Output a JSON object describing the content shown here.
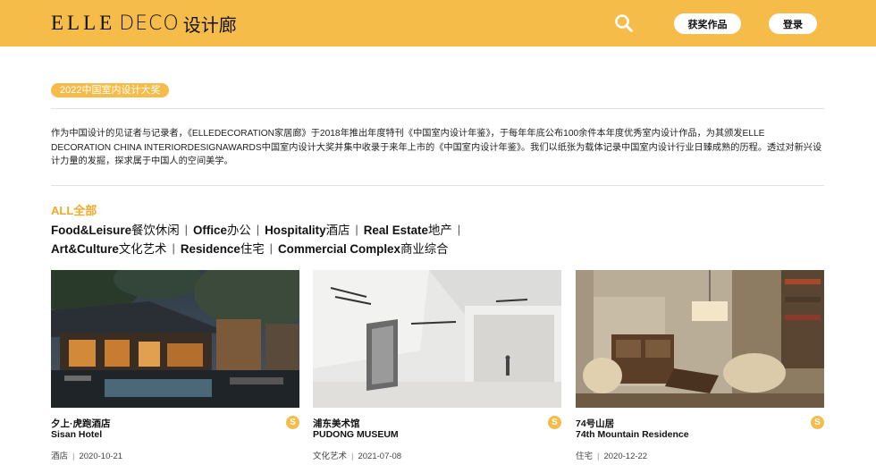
{
  "header": {
    "logo_elle": "ELLE",
    "logo_deco": "DECO",
    "logo_cn": "设计廊",
    "awards_label": "获奖作品",
    "login_label": "登录",
    "bg_color": "#f5bc4a"
  },
  "tag": "2022中国室内设计大奖",
  "description": "作为中国设计的见证者与记录者，《ELLEDECORATION家居廊》于2018年推出年度特刊《中国室内设计年鉴》，于每年年底公布100余件本年度优秀室内设计作品，为其颁发ELLE DECORATION CHINA INTERIORDESIGNAWARDS中国室内设计大奖并集中收录于来年上市的《中国室内设计年鉴》。我们以纸张为载体记录中国室内设计行业日臻成熟的历程。透过对新兴设计力量的发掘，探求属于中国人的空间美学。",
  "categories": {
    "all": "ALL全部",
    "line1": [
      {
        "en": "Food&Leisure",
        "cn": "餐饮休闲"
      },
      {
        "en": "Office",
        "cn": "办公"
      },
      {
        "en": "Hospitality",
        "cn": "酒店"
      },
      {
        "en": "Real Estate",
        "cn": "地产"
      }
    ],
    "line2": [
      {
        "en": "Art&Culture",
        "cn": "文化艺术"
      },
      {
        "en": "Residence",
        "cn": "住宅"
      },
      {
        "en": "Commercial Complex",
        "cn": "商业综合"
      }
    ],
    "separator": "|"
  },
  "cards": [
    {
      "title_cn": "夕上·虎跑酒店",
      "title_en": "Sisan Hotel",
      "category": "酒店",
      "date": "2020-10-21",
      "badge": "S"
    },
    {
      "title_cn": "浦东美术馆",
      "title_en": "PUDONG MUSEUM",
      "category": "文化艺术",
      "date": "2021-07-08",
      "badge": "S"
    },
    {
      "title_cn": "74号山居",
      "title_en": "74th Mountain Residence",
      "category": "住宅",
      "date": "2020-12-22",
      "badge": "S"
    }
  ],
  "meta_separator": "|",
  "icons": {
    "search": "search-icon",
    "badge": "s-badge-icon"
  }
}
